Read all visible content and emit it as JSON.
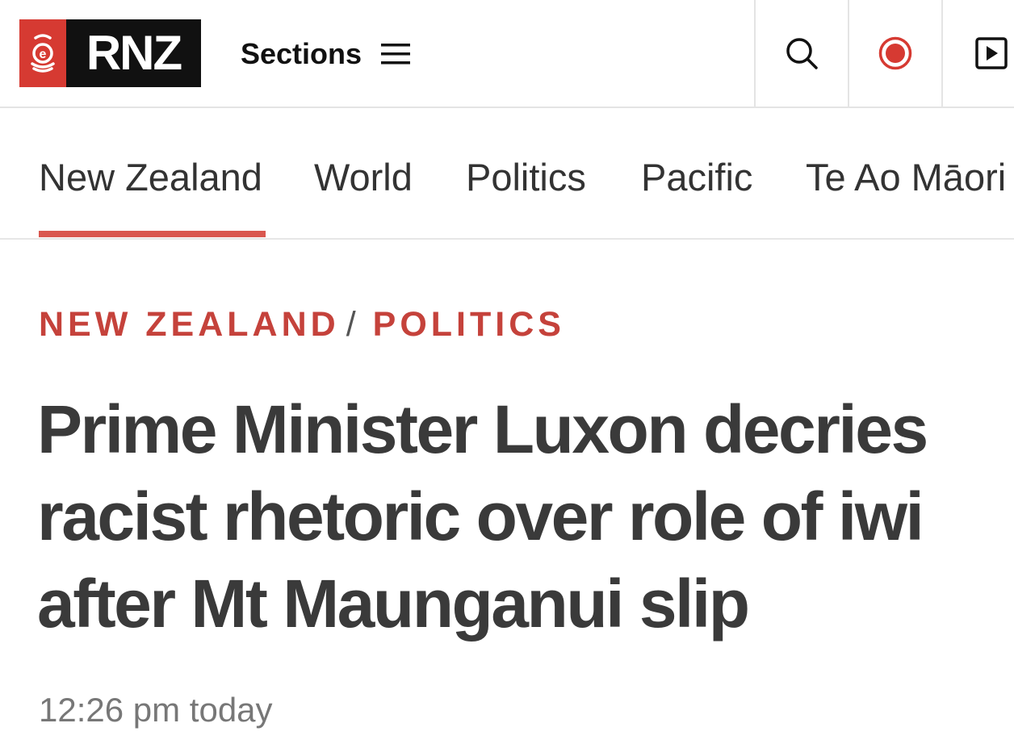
{
  "header": {
    "logo_text": "RNZ",
    "sections_label": "Sections",
    "icons": {
      "menu": "hamburger-icon",
      "search": "search-icon",
      "live": "live-record-icon",
      "play": "play-icon"
    },
    "colors": {
      "brand_red": "#d63a32",
      "brand_black": "#111111"
    }
  },
  "nav": {
    "tabs": [
      {
        "label": "New Zealand",
        "active": true
      },
      {
        "label": "World",
        "active": false
      },
      {
        "label": "Politics",
        "active": false
      },
      {
        "label": "Pacific",
        "active": false
      },
      {
        "label": "Te Ao Māori",
        "active": false
      }
    ],
    "active_color": "#d9574f"
  },
  "article": {
    "breadcrumb": {
      "primary": "NEW ZEALAND",
      "separator": "/",
      "secondary": "POLITICS",
      "color": "#c5423b"
    },
    "headline": "Prime Minister Luxon decries racist rhetoric over role of iwi after Mt Maunganui slip",
    "timestamp": "12:26 pm today"
  }
}
